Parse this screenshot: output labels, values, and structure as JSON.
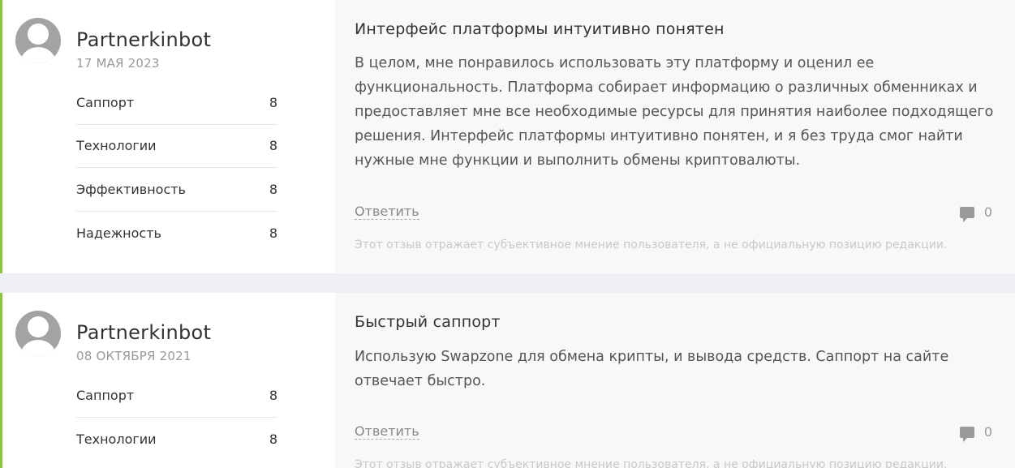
{
  "reviews": [
    {
      "author": "Partnerkinbot",
      "date": "17 МАЯ 2023",
      "ratings": [
        {
          "label": "Саппорт",
          "value": "8"
        },
        {
          "label": "Технологии",
          "value": "8"
        },
        {
          "label": "Эффективность",
          "value": "8"
        },
        {
          "label": "Надежность",
          "value": "8"
        }
      ],
      "title": "Интерфейс платформы интуитивно понятен",
      "text": "В целом, мне понравилось использовать эту платформу и оценил ее функциональность. Платформа собирает информацию о различных обменниках и предоставляет мне все необходимые ресурсы для принятия наиболее подходящего решения. Интерфейс платформы интуитивно понятен, и я без труда смог найти нужные мне функции и выполнить обмены криптовалюты.",
      "reply_label": "Ответить",
      "comment_count": "0",
      "disclaimer": "Этот отзыв отражает субъективное мнение пользователя, а не официальную позицию редакции."
    },
    {
      "author": "Partnerkinbot",
      "date": "08 ОКТЯБРЯ 2021",
      "ratings": [
        {
          "label": "Саппорт",
          "value": "8"
        },
        {
          "label": "Технологии",
          "value": "8"
        }
      ],
      "title": "Быстрый саппорт",
      "text": "Использую Swapzone для обмена крипты, и вывода средств. Саппорт на сайте отвечает быстро.",
      "reply_label": "Ответить",
      "comment_count": "0",
      "disclaimer": "Этот отзыв отражает субъективное мнение пользователя, а не официальную позицию редакции."
    }
  ],
  "colors": {
    "accent": "#8dc63f",
    "page_bg": "#eef0f3",
    "content_bg": "#f8f8f8"
  }
}
